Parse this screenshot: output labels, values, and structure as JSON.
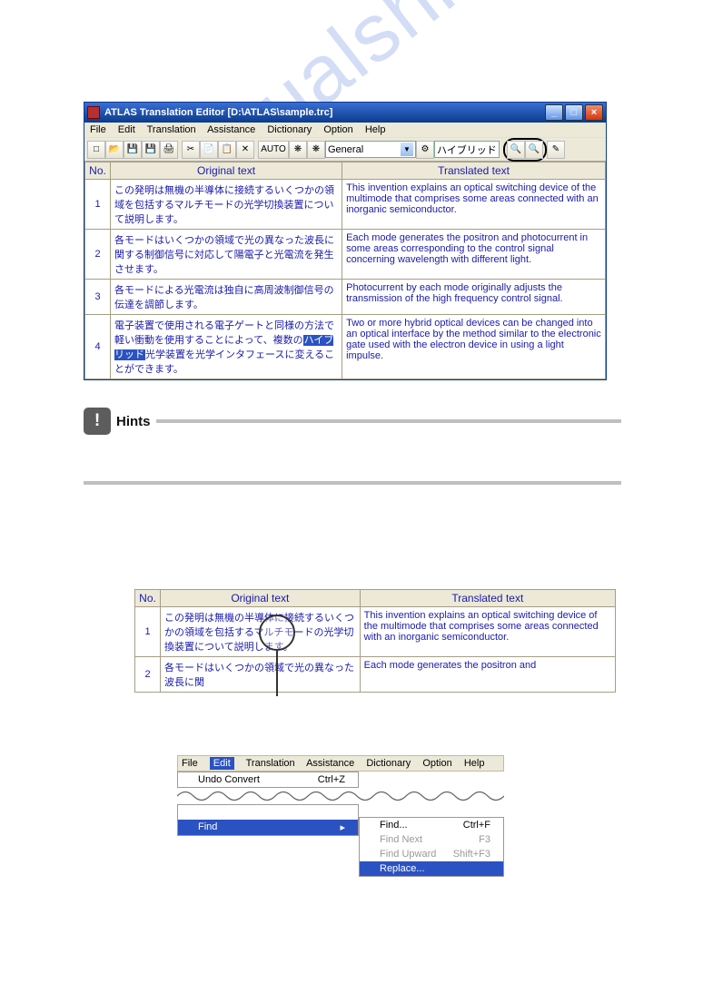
{
  "window": {
    "title": "ATLAS Translation Editor   [D:\\ATLAS\\sample.trc]",
    "menus": [
      "File",
      "Edit",
      "Translation",
      "Assistance",
      "Dictionary",
      "Option",
      "Help"
    ],
    "toolbar": {
      "auto_label": "AUTO",
      "dropdown1": "General",
      "dropdown2": "ハイブリッド"
    },
    "columns": {
      "no": "No.",
      "orig": "Original text",
      "trans": "Translated text"
    },
    "rows": [
      {
        "no": "1",
        "orig": "この発明は無機の半導体に接続するいくつかの領域を包括するマルチモードの光学切換装置について説明します。",
        "trans": "This invention explains an optical switching device of the multimode that comprises some areas connected with an inorganic semiconductor."
      },
      {
        "no": "2",
        "orig": "各モードはいくつかの領域で光の異なった波長に関する制御信号に対応して陽電子と光電流を発生させます。",
        "trans": "Each mode generates the positron and photocurrent in some areas corresponding to the control signal concerning wavelength with different light."
      },
      {
        "no": "3",
        "orig": "各モードによる光電流は独自に高周波制御信号の伝達を調節します。",
        "trans": "Photocurrent by each mode originally adjusts the transmission of the high frequency control signal."
      },
      {
        "no": "4",
        "orig_pre": "電子装置で使用される電子ゲートと同様の方法で軽い衝動を使用することによって、複数の",
        "orig_hl": "ハイブリッド",
        "orig_post": "光学装置を光学インタフェースに変えることができます。",
        "trans": "Two or more hybrid optical devices can be changed into an optical interface by the method similar to the electronic gate used with the electron device in using a light impulse."
      }
    ]
  },
  "hints": {
    "label": "Hints"
  },
  "table2": {
    "columns": {
      "no": "No.",
      "orig": "Original text",
      "trans": "Translated text"
    },
    "rows": [
      {
        "no": "1",
        "orig": "この発明は無機の半導体に接続するいくつかの領域を包括するマルチモードの光学切換装置について説明します。",
        "trans": "This invention explains an optical switching device of the multimode that comprises some areas connected with an inorganic semiconductor."
      },
      {
        "no": "2",
        "orig": "各モードはいくつかの領域で光の異なった波長に関",
        "trans": "Each mode generates the positron and"
      }
    ]
  },
  "edit_menu": {
    "menus": [
      "File",
      "Edit",
      "Translation",
      "Assistance",
      "Dictionary",
      "Option",
      "Help"
    ],
    "items": {
      "undo": {
        "label": "Undo Convert",
        "accel": "Ctrl+Z"
      },
      "find": {
        "label": "Find",
        "arrow": "▸"
      }
    },
    "submenu": {
      "find": {
        "label": "Find...",
        "accel": "Ctrl+F"
      },
      "findnext": {
        "label": "Find Next",
        "accel": "F3"
      },
      "findup": {
        "label": "Find Upward",
        "accel": "Shift+F3"
      },
      "replace": {
        "label": "Replace..."
      }
    }
  },
  "watermark": "manualshive.com"
}
